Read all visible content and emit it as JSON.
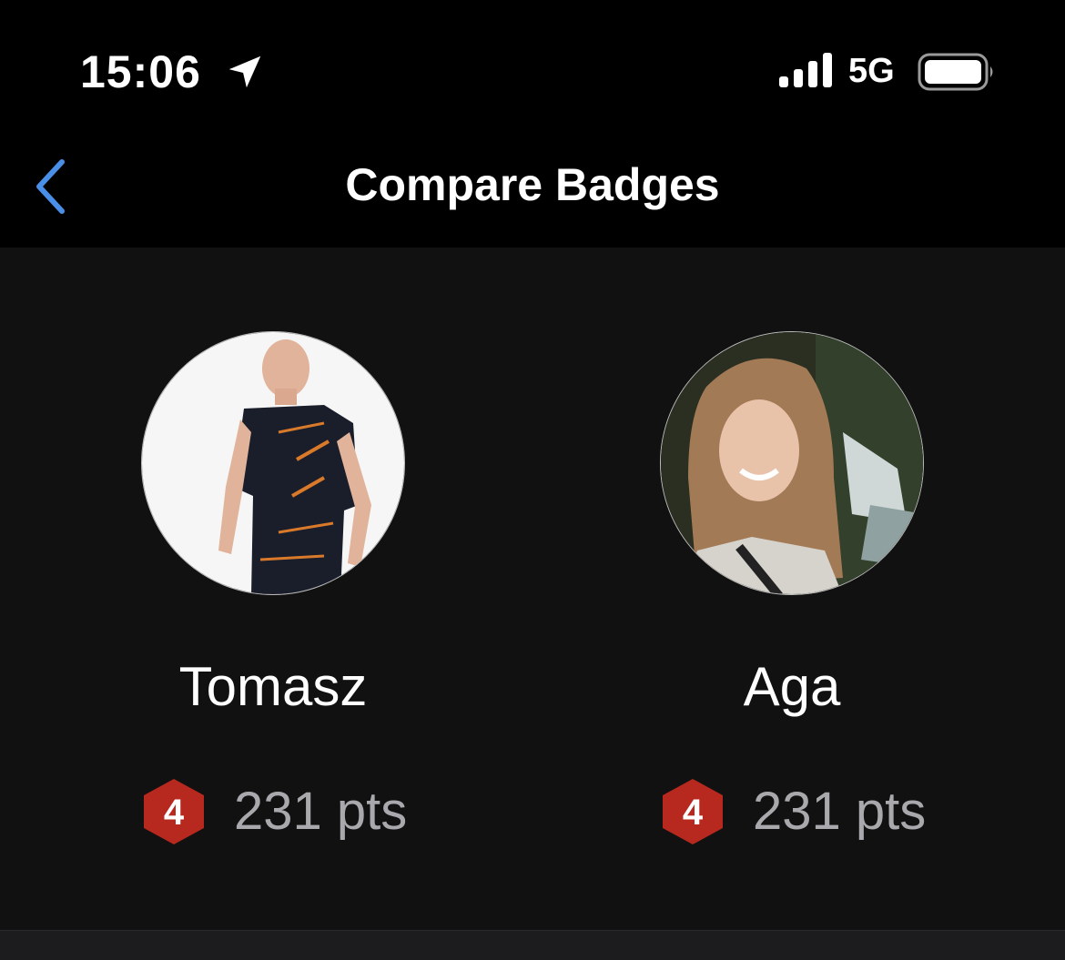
{
  "status_bar": {
    "time": "15:06",
    "network": "5G",
    "location_icon": "location-arrow-icon",
    "signal_icon": "cellular-signal-icon",
    "battery_icon": "battery-full-icon"
  },
  "nav": {
    "title": "Compare Badges",
    "back_icon": "chevron-left-icon",
    "accent_color": "#3b82f6"
  },
  "users": [
    {
      "name": "Tomasz",
      "level": "4",
      "points": "231 pts"
    },
    {
      "name": "Aga",
      "level": "4",
      "points": "231 pts"
    }
  ],
  "colors": {
    "background": "#000000",
    "content_background": "#111111",
    "badge_red": "#b7281f",
    "points_gray": "#a9a9ad"
  }
}
